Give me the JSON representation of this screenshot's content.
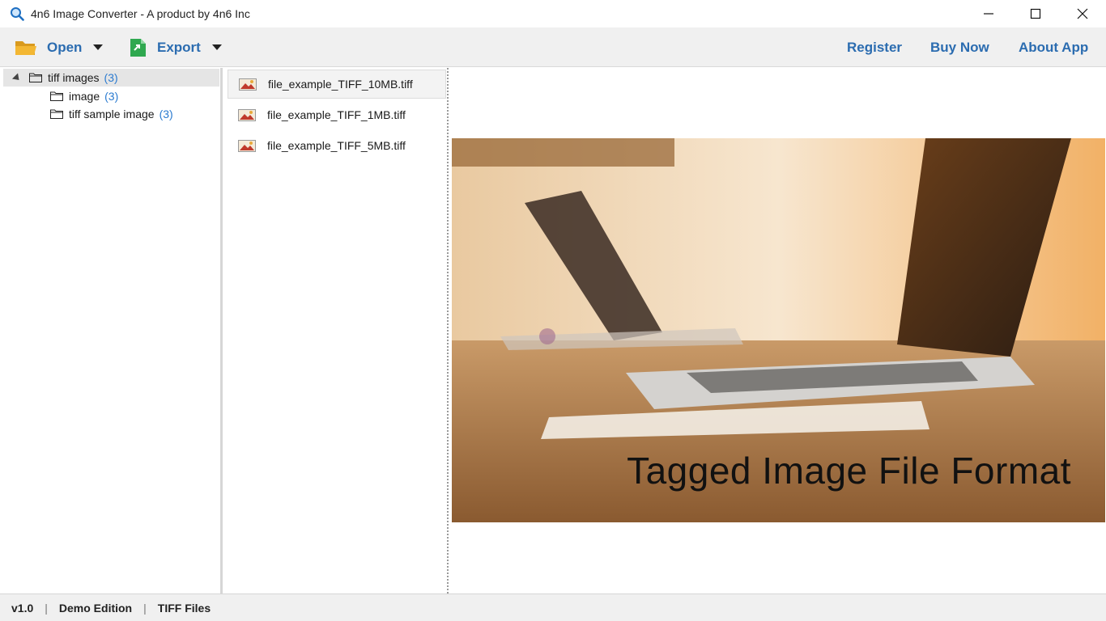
{
  "window": {
    "title": "4n6 Image Converter - A product by 4n6 Inc",
    "app_icon": "magnifier-icon",
    "controls": [
      "minimize-icon",
      "maximize-icon",
      "close-icon"
    ]
  },
  "toolbar": {
    "open_label": "Open",
    "open_icon": "folder-open-icon",
    "export_label": "Export",
    "export_icon": "export-file-icon",
    "register_label": "Register",
    "buy_now_label": "Buy Now",
    "about_label": "About App",
    "accent_color": "#2b6cb0"
  },
  "tree": {
    "root": {
      "label": "tiff images",
      "count": "(3)"
    },
    "children": [
      {
        "label": "image",
        "count": "(3)"
      },
      {
        "label": "tiff sample image",
        "count": "(3)"
      }
    ]
  },
  "files": [
    {
      "name": "file_example_TIFF_10MB.tiff",
      "selected": true
    },
    {
      "name": "file_example_TIFF_1MB.tiff",
      "selected": false
    },
    {
      "name": "file_example_TIFF_5MB.tiff",
      "selected": false
    }
  ],
  "preview": {
    "caption": "Tagged Image File Format"
  },
  "status": {
    "version": "v1.0",
    "edition": "Demo Edition",
    "file_type": "TIFF Files",
    "separator": "|"
  }
}
